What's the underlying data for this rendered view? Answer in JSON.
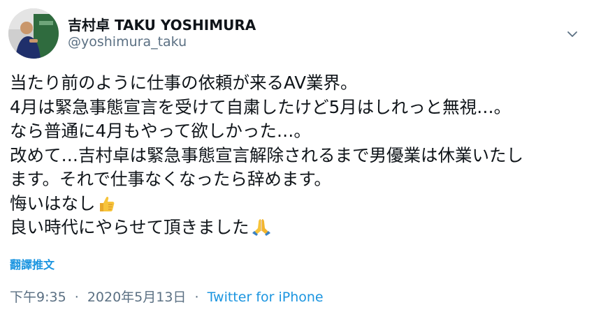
{
  "author": {
    "display_name": "吉村卓 TAKU YOSHIMURA",
    "handle": "@yoshimura_taku",
    "avatar": "profile-photo"
  },
  "menu_icon": "chevron-down-icon",
  "tweet": {
    "lines": [
      "当たり前のように仕事の依頼が来るAV業界。",
      "4月は緊急事態宣言を受けて自粛したけど5月はしれっと無視…。",
      "なら普通に4月もやって欲しかった…。",
      "改めて…吉村卓は緊急事態宣言解除されるまで男優業は休業いたし",
      "ます。それで仕事なくなったら辞めます。",
      "悔いはなし",
      "良い時代にやらせて頂きました"
    ],
    "emojis": {
      "thumbs_up": "thumbs-up-emoji",
      "folded_hands": "folded-hands-emoji"
    }
  },
  "translate_label": "翻譯推文",
  "meta": {
    "time": "下午9:35",
    "separator": "·",
    "date": "2020年5月13日",
    "source": "Twitter for iPhone"
  },
  "colors": {
    "text": "#0f1419",
    "secondary": "#5b7083",
    "link": "#1b95e0"
  }
}
